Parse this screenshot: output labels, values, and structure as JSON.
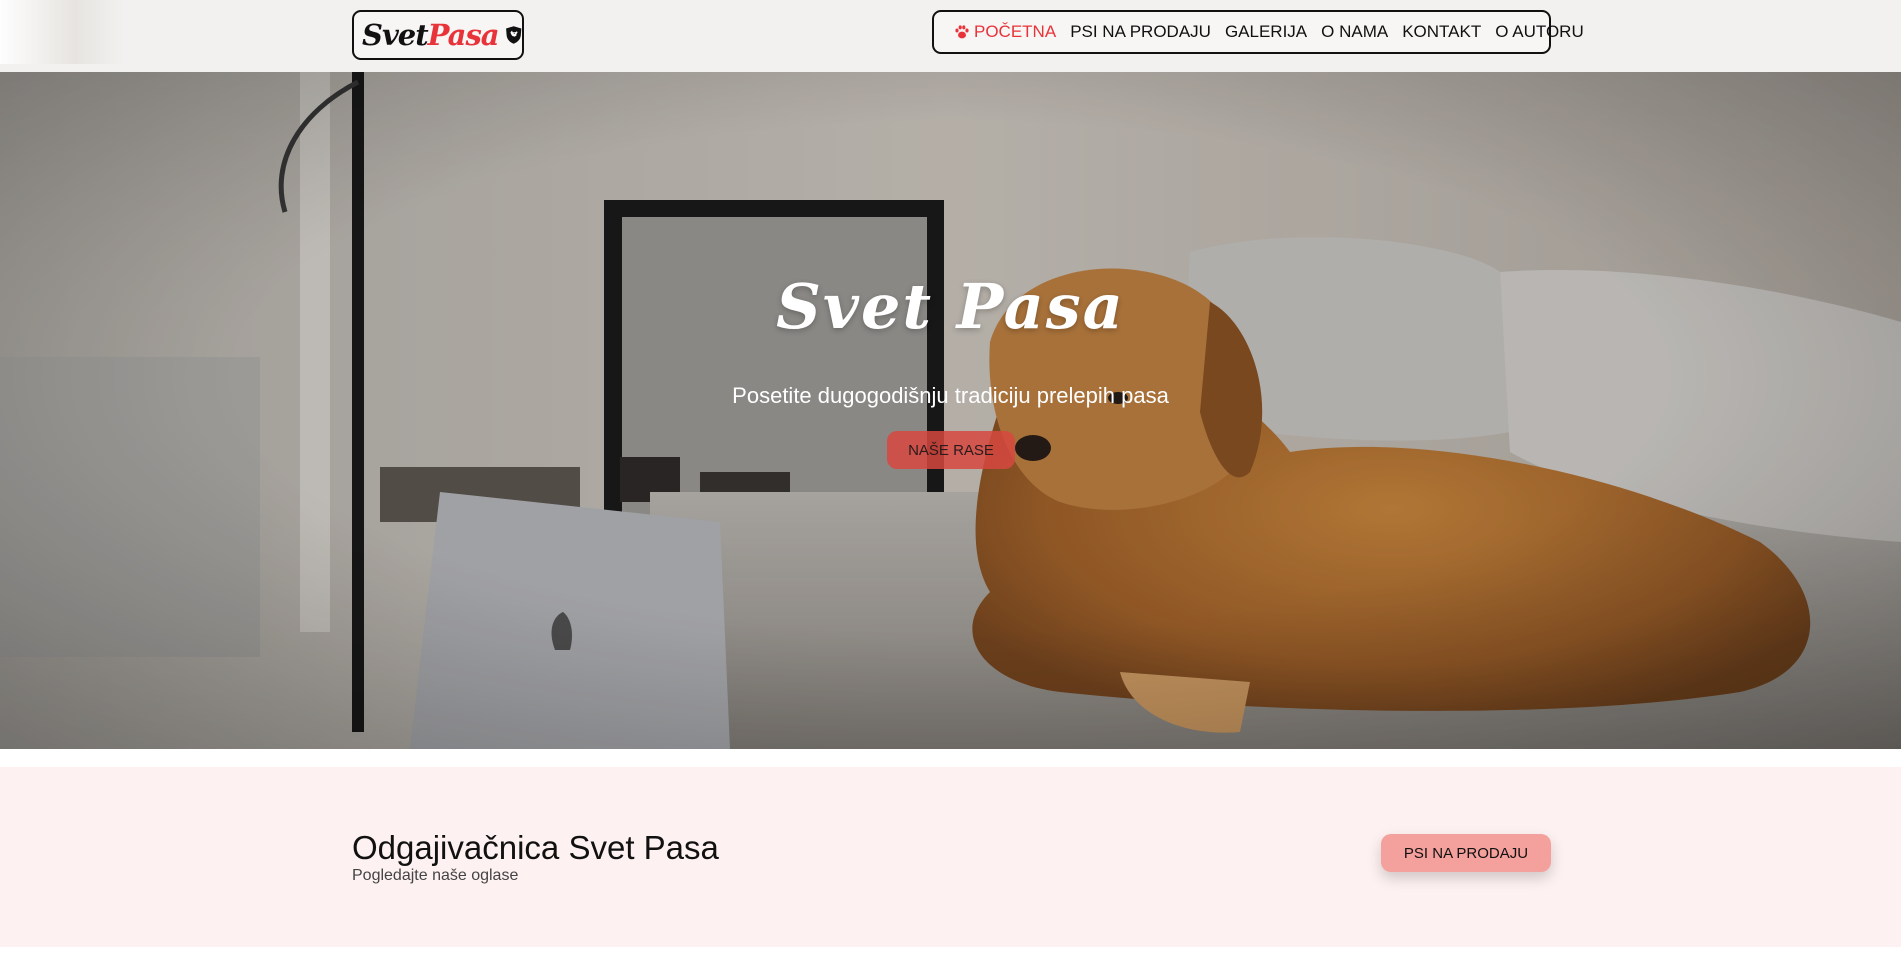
{
  "header": {
    "logo": {
      "part1": "Svet",
      "part2": "Pasa",
      "icon": "shield-dog-icon"
    },
    "nav": [
      {
        "label": "POČETNA",
        "active": true,
        "icon": "paw-icon"
      },
      {
        "label": "PSI NA PRODAJU",
        "active": false
      },
      {
        "label": "GALERIJA",
        "active": false
      },
      {
        "label": "O NAMA",
        "active": false
      },
      {
        "label": "KONTAKT",
        "active": false
      },
      {
        "label": "O AUTORU",
        "active": false
      }
    ]
  },
  "hero": {
    "title": "Svet Pasa",
    "subtitle": "Posetite dugogodišnju tradiciju prelepih pasa",
    "button_label": "NAŠE RASE"
  },
  "breeder": {
    "title": "Odgajivačnica Svet Pasa",
    "subtitle": "Pogledajte naše oglase",
    "button_label": "PSI NA PRODAJU"
  },
  "colors": {
    "accent": "#e8333a",
    "header_bg": "#f2f1ef",
    "strip_bg": "#fdf1f1",
    "strip_button": "#f4a09c"
  }
}
